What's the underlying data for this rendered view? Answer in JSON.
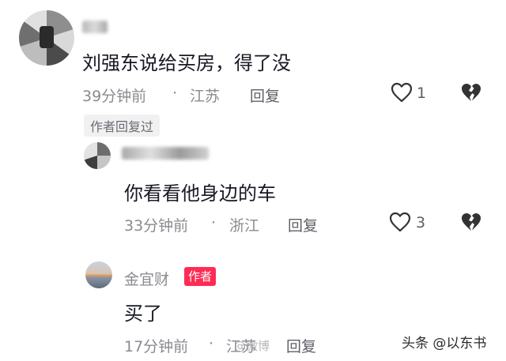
{
  "comments": [
    {
      "text": "刘强东说给买房，得了没",
      "time": "39分钟前",
      "location": "江苏",
      "reply_label": "回复",
      "likes": "1"
    },
    {
      "author_replied": "作者回复过",
      "text": "你看看他身边的车",
      "time": "33分钟前",
      "location": "浙江",
      "reply_label": "回复",
      "likes": "3"
    },
    {
      "name": "金宜财",
      "badge": "作者",
      "text": "买了",
      "time": "17分钟前",
      "location": "江苏",
      "reply_label": "回复"
    }
  ],
  "watermarks": {
    "weibo": "@微博",
    "toutiao": "头条 @以东书"
  },
  "colors": {
    "badge": "#fe2c55",
    "meta": "#8a8b91"
  }
}
